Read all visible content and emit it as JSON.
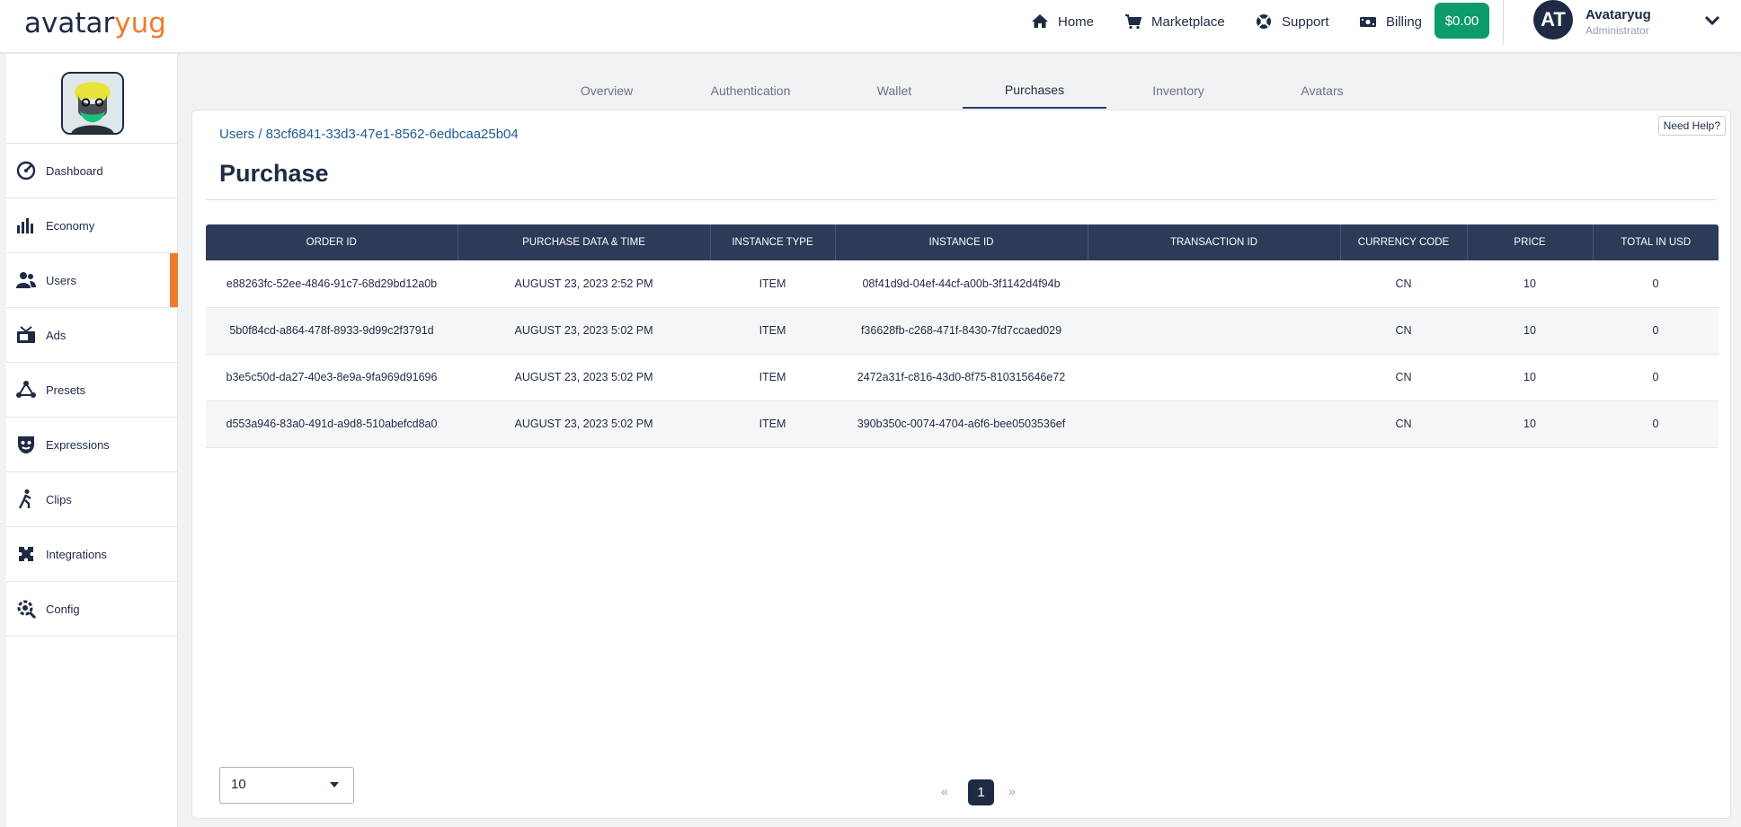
{
  "brand": {
    "part1": "avatar",
    "part2": "yug"
  },
  "topnav": {
    "items": [
      {
        "label": "Home",
        "icon": "home-icon"
      },
      {
        "label": "Marketplace",
        "icon": "cart-icon"
      },
      {
        "label": "Support",
        "icon": "support-icon"
      },
      {
        "label": "Billing",
        "icon": "billing-icon"
      }
    ],
    "wallet_balance": "$0.00",
    "user": {
      "initials": "AT",
      "name": "Avataryug",
      "role": "Administrator"
    }
  },
  "sidebar": {
    "items": [
      {
        "label": "Dashboard",
        "icon": "dashboard-icon"
      },
      {
        "label": "Economy",
        "icon": "economy-icon"
      },
      {
        "label": "Users",
        "icon": "users-icon",
        "active": true
      },
      {
        "label": "Ads",
        "icon": "ads-icon"
      },
      {
        "label": "Presets",
        "icon": "presets-icon"
      },
      {
        "label": "Expressions",
        "icon": "expressions-icon"
      },
      {
        "label": "Clips",
        "icon": "clips-icon"
      },
      {
        "label": "Integrations",
        "icon": "integrations-icon"
      },
      {
        "label": "Config",
        "icon": "config-icon"
      }
    ]
  },
  "tabs": [
    {
      "label": "Overview"
    },
    {
      "label": "Authentication"
    },
    {
      "label": "Wallet"
    },
    {
      "label": "Purchases",
      "active": true
    },
    {
      "label": "Inventory"
    },
    {
      "label": "Avatars"
    }
  ],
  "main": {
    "help_label": "Need Help?",
    "breadcrumb": "Users / 83cf6841-33d3-47e1-8562-6edbcaa25b04",
    "title": "Purchase",
    "table": {
      "headers": [
        "ORDER ID",
        "PURCHASE DATA & TIME",
        "INSTANCE TYPE",
        "INSTANCE ID",
        "TRANSACTION ID",
        "CURRENCY CODE",
        "PRICE",
        "TOTAL IN USD"
      ],
      "rows": [
        [
          "e88263fc-52ee-4846-91c7-68d29bd12a0b",
          "AUGUST 23, 2023 2:52 PM",
          "ITEM",
          "08f41d9d-04ef-44cf-a00b-3f1142d4f94b",
          "",
          "CN",
          "10",
          "0"
        ],
        [
          "5b0f84cd-a864-478f-8933-9d99c2f3791d",
          "AUGUST 23, 2023 5:02 PM",
          "ITEM",
          "f36628fb-c268-471f-8430-7fd7ccaed029",
          "",
          "CN",
          "10",
          "0"
        ],
        [
          "b3e5c50d-da27-40e3-8e9a-9fa969d91696",
          "AUGUST 23, 2023 5:02 PM",
          "ITEM",
          "2472a31f-c816-43d0-8f75-810315646e72",
          "",
          "CN",
          "10",
          "0"
        ],
        [
          "d553a946-83a0-491d-a9d8-510abefcd8a0",
          "AUGUST 23, 2023 5:02 PM",
          "ITEM",
          "390b350c-0074-4704-a6f6-bee0503536ef",
          "",
          "CN",
          "10",
          "0"
        ]
      ]
    },
    "page_size": "10",
    "pagination": {
      "prev": "«",
      "current": "1",
      "next": "»"
    }
  },
  "colors": {
    "accent": "#f07b2c",
    "navy": "#1f2a44",
    "wallet": "#0e9b6b",
    "link": "#1f5b94"
  }
}
